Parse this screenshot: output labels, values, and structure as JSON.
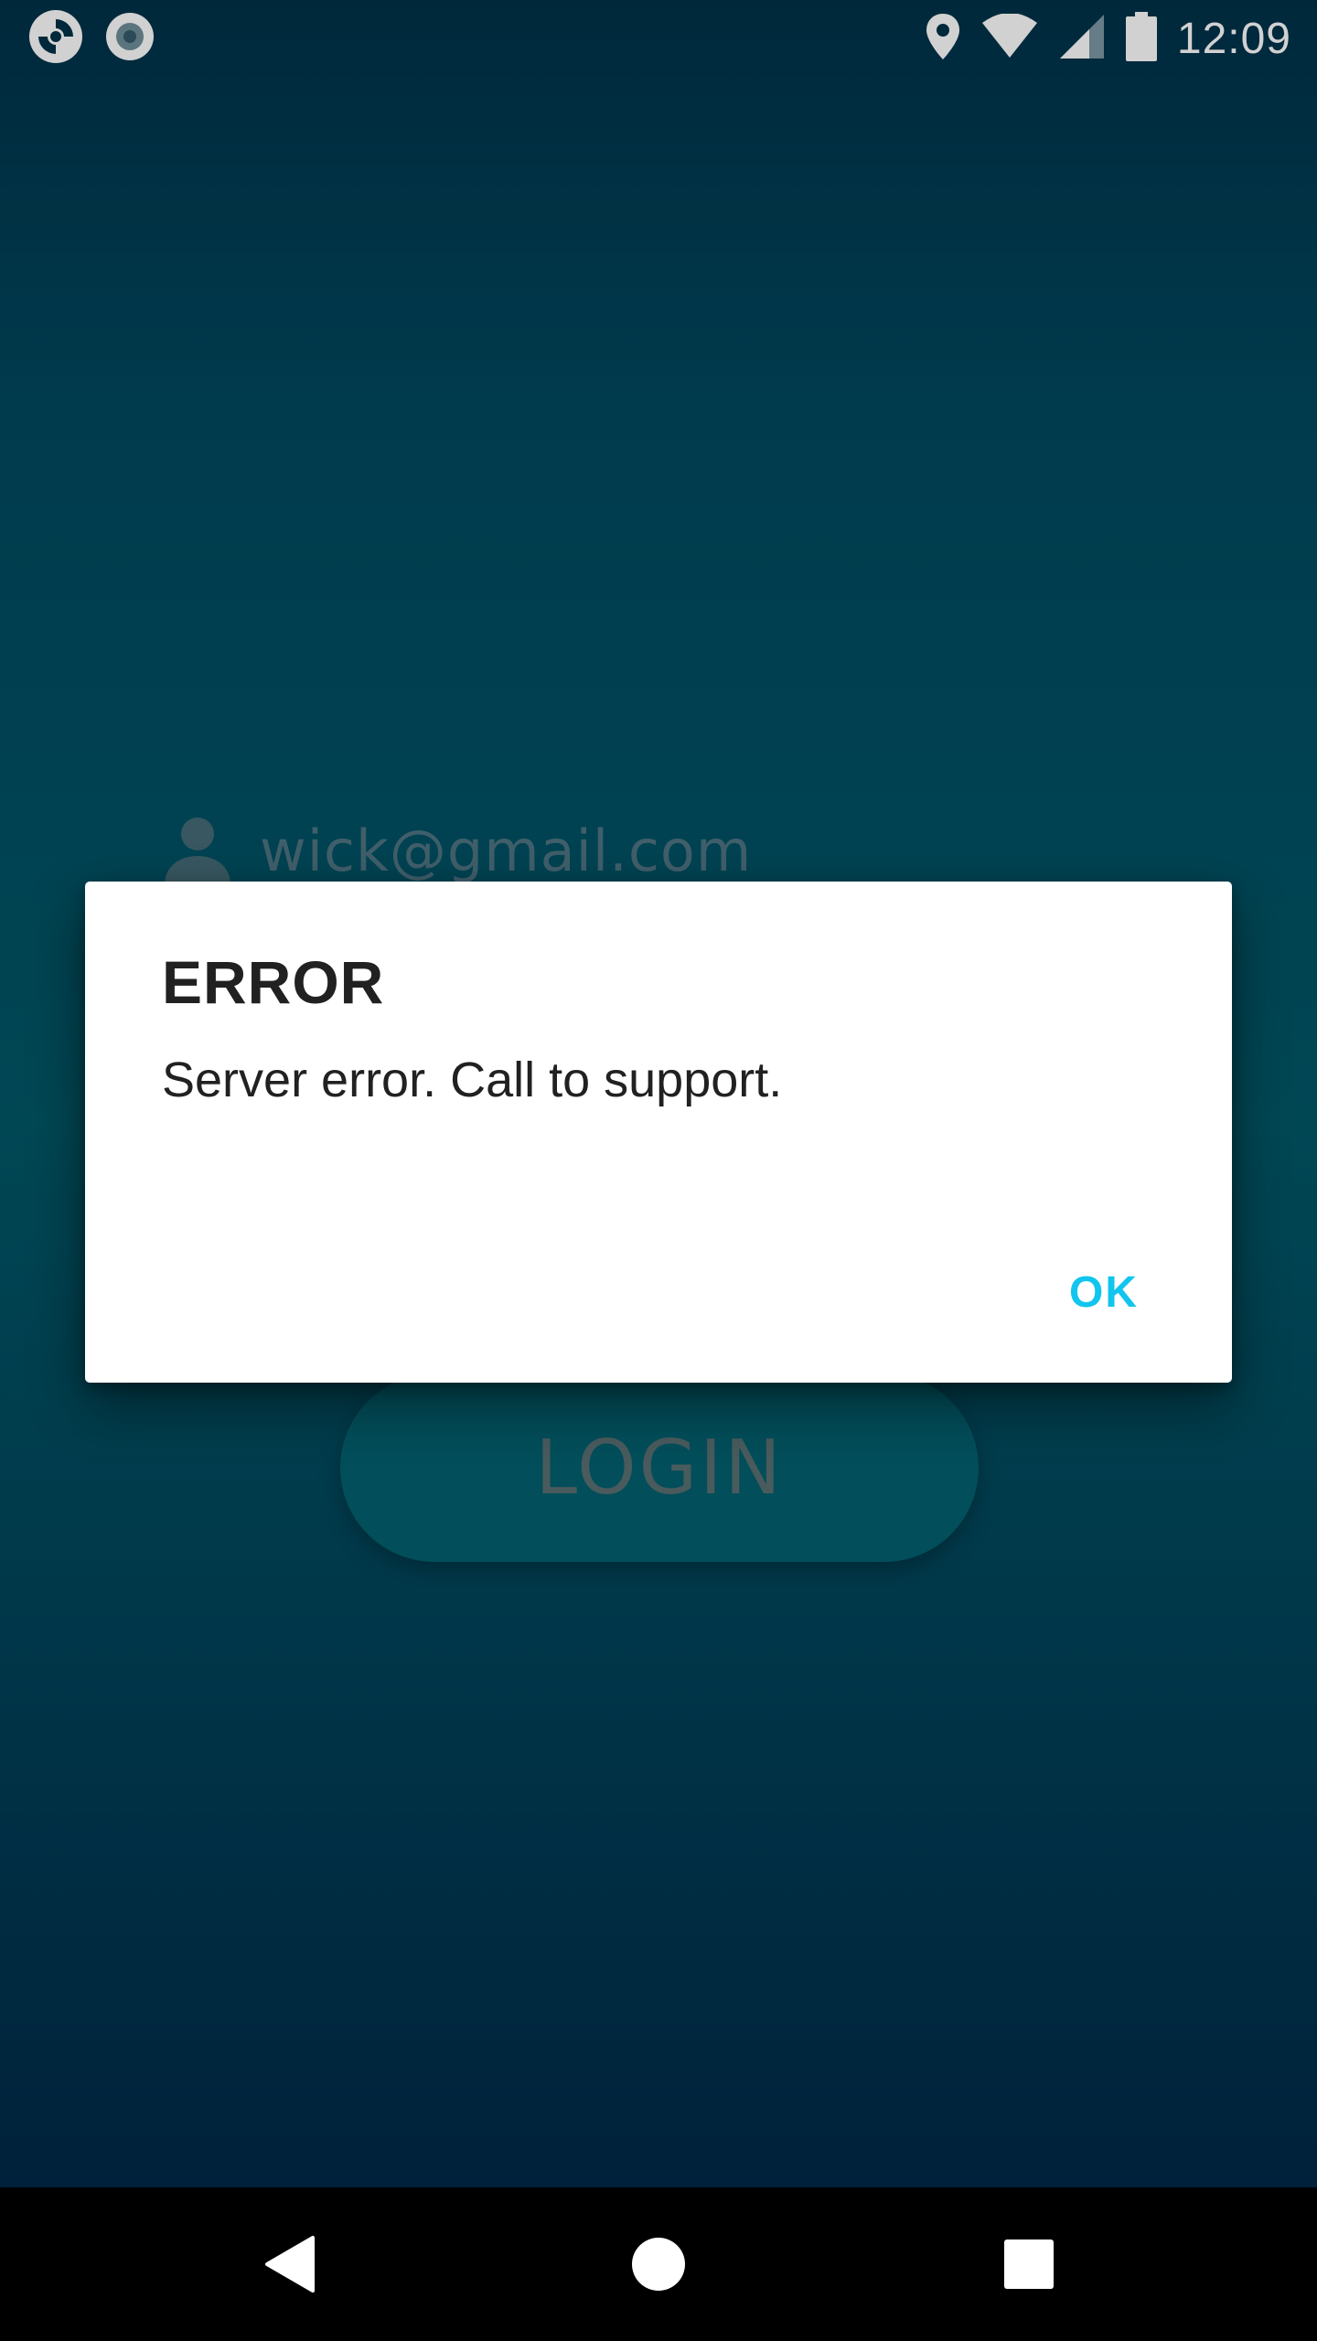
{
  "status_bar": {
    "time": "12:09",
    "icons_left": [
      "app-refresh-icon",
      "record-icon"
    ],
    "icons_right": [
      "location-icon",
      "wifi-icon",
      "signal-icon",
      "battery-icon"
    ]
  },
  "login_form": {
    "email_value": "wick@gmail.com",
    "login_label": "LOGIN",
    "user_icon": "person-icon"
  },
  "dialog": {
    "title": "ERROR",
    "message": "Server error. Call to support.",
    "ok_label": "OK",
    "accent_color": "#12c5ee"
  },
  "nav_bar": {
    "buttons": [
      "back-icon",
      "home-icon",
      "recents-icon"
    ]
  }
}
